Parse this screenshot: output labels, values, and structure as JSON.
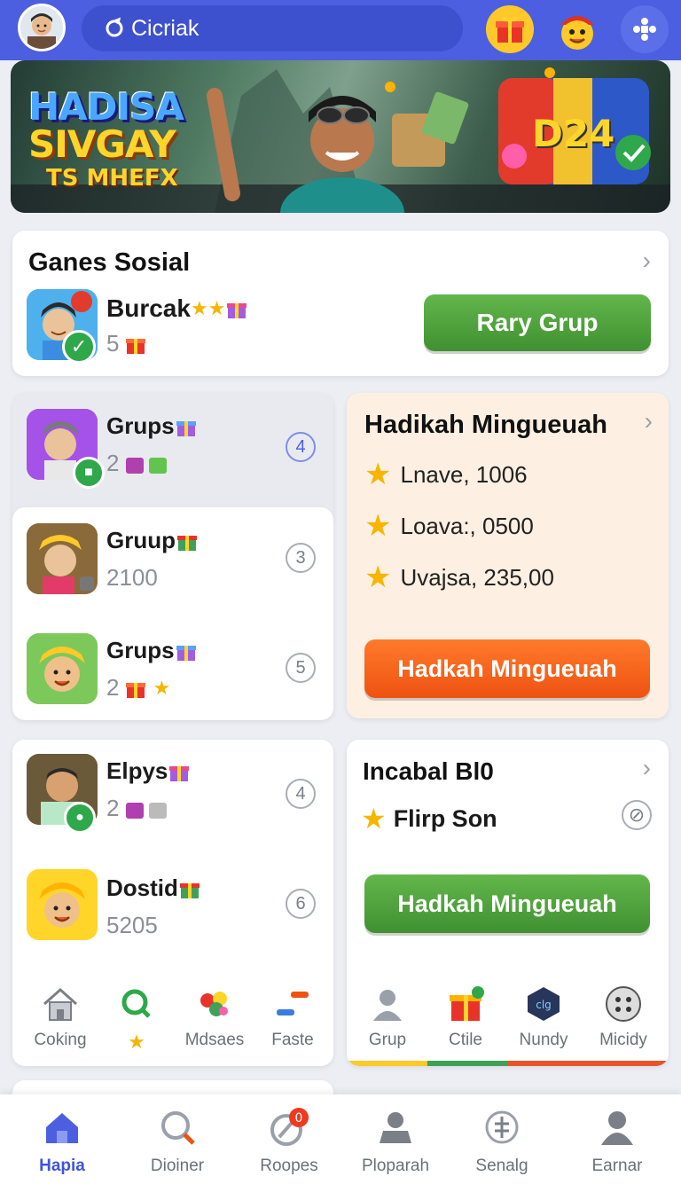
{
  "header": {
    "search_text": "Cicriak",
    "colors": {
      "bar": "#4b5fe0",
      "search": "#3d51cf"
    }
  },
  "banner": {
    "line1": "HADISA",
    "line2": "SIVGAY",
    "line3": "TS MHEFX",
    "chest_text": "D24"
  },
  "games_social": {
    "title": "Ganes Sosial",
    "item_name": "Burcak",
    "item_count": "5",
    "button": "Rary Grup"
  },
  "group_list_1": [
    {
      "name": "Grups",
      "count": "2",
      "badge": "4"
    }
  ],
  "group_list_2": [
    {
      "name": "Gruup",
      "count": "2100",
      "badge": "3"
    },
    {
      "name": "Grups",
      "count": "2",
      "badge": "5"
    }
  ],
  "group_list_3": [
    {
      "name": "Elpys",
      "count": "2",
      "badge": "4"
    },
    {
      "name": "Dostid",
      "count": "5205",
      "badge": "6"
    }
  ],
  "rewards": {
    "title": "Hadikah Mingueuah",
    "rows": [
      "Lnave, 1006",
      "Loava:, 0500",
      "Uvajsa, 235,00"
    ],
    "button": "Hadkah Mingueuah"
  },
  "incabal": {
    "title": "Incabal Bl0",
    "item": "Flirp Son",
    "button": "Hadkah Mingueuah"
  },
  "mini_nav_left": [
    "Coking",
    "",
    "Mdsaes",
    "Faste"
  ],
  "mini_nav_right": [
    "Grup",
    "Ctile",
    "Nundy",
    "Micidy"
  ],
  "bottom_nav": [
    {
      "label": "Hapia",
      "icon": "home-icon",
      "active": true
    },
    {
      "label": "Dioiner",
      "icon": "search-icon"
    },
    {
      "label": "Roopes",
      "icon": "compass-icon",
      "badge": "0"
    },
    {
      "label": "Ploparah",
      "icon": "profile-card-icon"
    },
    {
      "label": "Senalg",
      "icon": "equal-circle-icon"
    },
    {
      "label": "Earnar",
      "icon": "user-icon"
    }
  ]
}
